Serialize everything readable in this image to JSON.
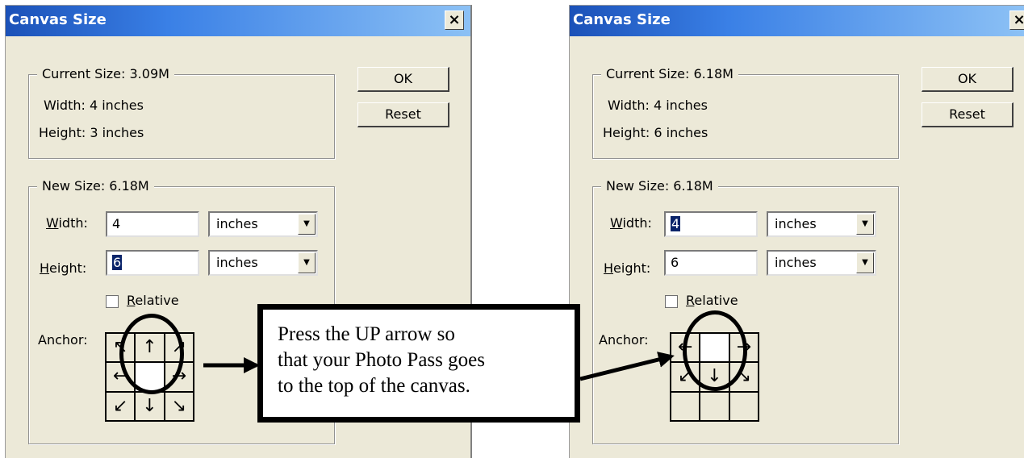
{
  "left_dialog": {
    "title": "Canvas Size",
    "close_glyph": "×",
    "current_size": {
      "label": "Current Size:  3.09M",
      "width": "Width:  4 inches",
      "height": "Height:  3 inches"
    },
    "buttons": {
      "ok": "OK",
      "reset": "Reset"
    },
    "new_size": {
      "label": "New Size:  6.18M",
      "width_label_u": "W",
      "width_label_rest": "idth:",
      "width_value": "4",
      "height_label_u": "H",
      "height_label_rest": "eight:",
      "height_value": "6",
      "width_unit": "inches",
      "height_unit": "inches",
      "relative_label_u": "R",
      "relative_label_rest": "elative",
      "anchor_label": "Anchor:",
      "anchor_cells": [
        "↖",
        "↑",
        "↗",
        "←",
        "",
        "→",
        "↙",
        "↓",
        "↘"
      ]
    }
  },
  "right_dialog": {
    "title": "Canvas Size",
    "close_glyph": "×",
    "current_size": {
      "label": "Current Size:  6.18M",
      "width": "Width:  4 inches",
      "height": "Height:  6 inches"
    },
    "buttons": {
      "ok": "OK",
      "reset": "Reset"
    },
    "new_size": {
      "label": "New Size:  6.18M",
      "width_label_u": "W",
      "width_label_rest": "idth:",
      "width_value": "4",
      "height_label_u": "H",
      "height_label_rest": "eight:",
      "height_value": "6",
      "width_unit": "inches",
      "height_unit": "inches",
      "relative_label_u": "R",
      "relative_label_rest": "elative",
      "anchor_label": "Anchor:",
      "anchor_cells": [
        "←",
        "",
        "→",
        "↙",
        "↓",
        "↘",
        "",
        "",
        ""
      ]
    }
  },
  "callout": {
    "line1": "Press the UP arrow so",
    "line2": "that your Photo Pass goes",
    "line3": "to the top of the canvas."
  }
}
